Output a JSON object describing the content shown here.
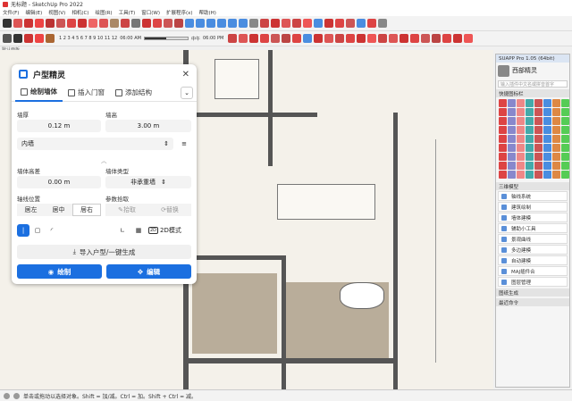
{
  "window": {
    "title": "无标题 - SketchUp Pro 2022"
  },
  "menu": [
    "文件(F)",
    "编辑(E)",
    "视图(V)",
    "相机(C)",
    "绘图(R)",
    "工具(T)",
    "窗口(W)",
    "扩展程序(x)",
    "帮助(H)"
  ],
  "toolbar_scale": {
    "left": "1 2 3 4 5 6 7 8 9 10 11 12",
    "time1": "06:00 AM",
    "mid": "中午",
    "time2": "06:00 PM"
  },
  "canvas": {
    "label": "默认面板"
  },
  "status": {
    "text": "单击或拖动以选择对象。Shift = 加/减。Ctrl = 加。Shift + Ctrl = 减。"
  },
  "panel": {
    "title": "户型精灵",
    "tabs": [
      "绘制墙体",
      "插入门窗",
      "添加结构"
    ],
    "wall_thickness_label": "墙厚",
    "wall_thickness": "0.12 m",
    "wall_height_label": "墙高",
    "wall_height": "3.00 m",
    "wall_type_select": "内墙",
    "wall_offset_label": "墙体高差",
    "wall_offset": "0.00 m",
    "wall_kind_label": "墙体类型",
    "wall_kind": "非承重墙",
    "axis_label": "轴线位置",
    "axis_options": [
      "居左",
      "居中",
      "居右"
    ],
    "params_label": "参数拾取",
    "pick_label": "拾取",
    "replace_label": "替换",
    "mode_2d": "2D模式",
    "import_label": "导入户型/一键生成",
    "draw_label": "绘制",
    "edit_label": "编辑"
  },
  "rpanel": {
    "title": "SUAPP Pro 1.05 (64bit)",
    "user": "西部精灵",
    "search_placeholder": "输入插件中文名或拼音首字",
    "section1": "快捷图标栏",
    "section2": "三维模型",
    "items": [
      "轴线系统",
      "建筑绘制",
      "墙体建模",
      "辅助小工具",
      "景观曲线",
      "多边建模",
      "自动建模",
      "MAJ插件合",
      "图层管理"
    ],
    "section3": "图纸生成",
    "section4": "最近命令"
  },
  "colors": {
    "accent": "#1b6fe0",
    "floor": "#b9ad9a",
    "canvas": "#f4f1ea"
  }
}
